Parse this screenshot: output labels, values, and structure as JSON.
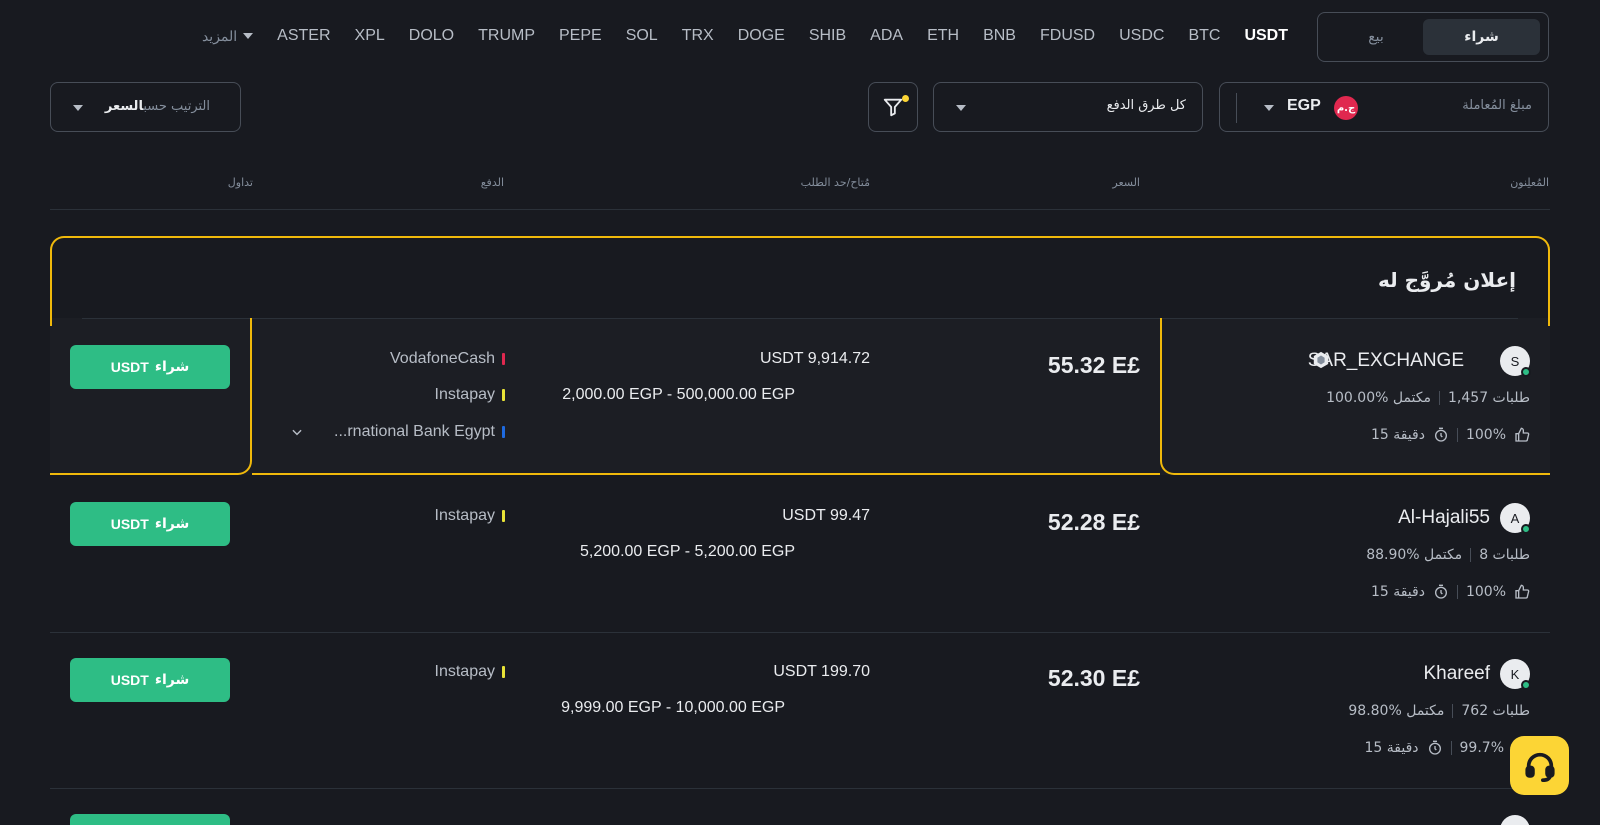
{
  "header": {
    "toggle": {
      "buy": "شراء",
      "sell": "بيع"
    },
    "coins": [
      "USDT",
      "BTC",
      "USDC",
      "FDUSD",
      "BNB",
      "ETH",
      "ADA",
      "SHIB",
      "DOGE",
      "TRX",
      "SOL",
      "PEPE",
      "TRUMP",
      "DOLO",
      "XPL",
      "ASTER"
    ],
    "more": "المزيد"
  },
  "filters": {
    "amount_placeholder": "مبلغ المُعاملة",
    "currency": "EGP",
    "currency_flag": "ج.م",
    "payment": "كل طرق الدفع",
    "sort_prefix": "الترتيب حسب",
    "sort_value": "السعر"
  },
  "table_headers": {
    "advertisers": "المُعلِنون",
    "price": "السعر",
    "available": "مُتاح/حد الطلب",
    "payment": "الدفع",
    "trade": "تداول"
  },
  "promoted_title": "إعلان مُروَّج له",
  "rows": [
    {
      "initial": "S",
      "name": "SAR_EXCHANGE",
      "orders": "1,457 طلبات",
      "completion": "100.00% مكتمل",
      "rating": "100%",
      "time": "15 دقيقة",
      "price": "55.32",
      "currency_symbol": "E£",
      "available": "USDT 9,914.72",
      "limit": "2,000.00 EGP - 500,000.00 EGP",
      "payments": [
        {
          "name": "VodafoneCash",
          "color": "#e0284f"
        },
        {
          "name": "Instapay",
          "color": "#e8e337"
        },
        {
          "name": "...rnational Bank Egypt",
          "color": "#1e6ae0"
        }
      ],
      "button_action": "شراء",
      "button_coin": "USDT"
    },
    {
      "initial": "A",
      "name": "Al-Hajali55",
      "orders": "8 طلبات",
      "completion": "88.90% مكتمل",
      "rating": "100%",
      "time": "15 دقيقة",
      "price": "52.28",
      "currency_symbol": "E£",
      "available": "USDT 99.47",
      "limit": "5,200.00 EGP - 5,200.00 EGP",
      "payments": [
        {
          "name": "Instapay",
          "color": "#e8e337"
        }
      ],
      "button_action": "شراء",
      "button_coin": "USDT"
    },
    {
      "initial": "K",
      "name": "Khareef",
      "orders": "762 طلبات",
      "completion": "98.80% مكتمل",
      "rating": "99.7%",
      "time": "15 دقيقة",
      "price": "52.30",
      "currency_symbol": "E£",
      "available": "USDT 199.70",
      "limit": "9,999.00 EGP - 10,000.00 EGP",
      "payments": [
        {
          "name": "Instapay",
          "color": "#e8e337"
        }
      ],
      "button_action": "شراء",
      "button_coin": "USDT"
    }
  ],
  "colors": {
    "buy_green": "#2ebd85",
    "promo_gold": "#f0b90b",
    "background": "#181a20"
  }
}
